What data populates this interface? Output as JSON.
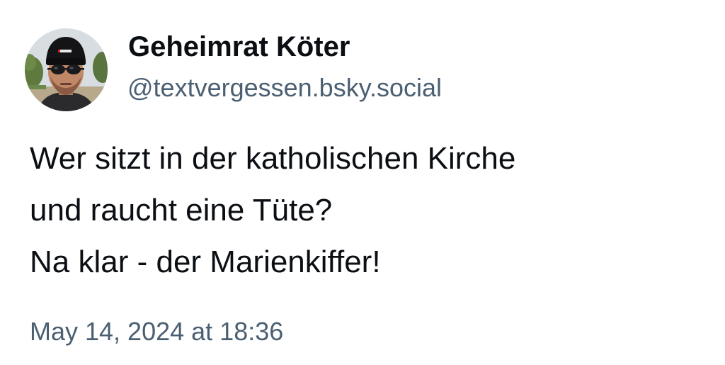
{
  "post": {
    "author": {
      "display_name": "Geheimrat Köter",
      "handle": "@textvergessen.bsky.social",
      "avatar": "profile-photo"
    },
    "text_lines": [
      "Wer sitzt in der katholischen Kirche",
      "und raucht eine Tüte?",
      "Na klar - der Marienkiffer!"
    ],
    "timestamp": "May 14, 2024 at 18:36"
  },
  "colors": {
    "text": "#0b0f14",
    "secondary_text": "#4b5f73",
    "background": "#ffffff"
  }
}
